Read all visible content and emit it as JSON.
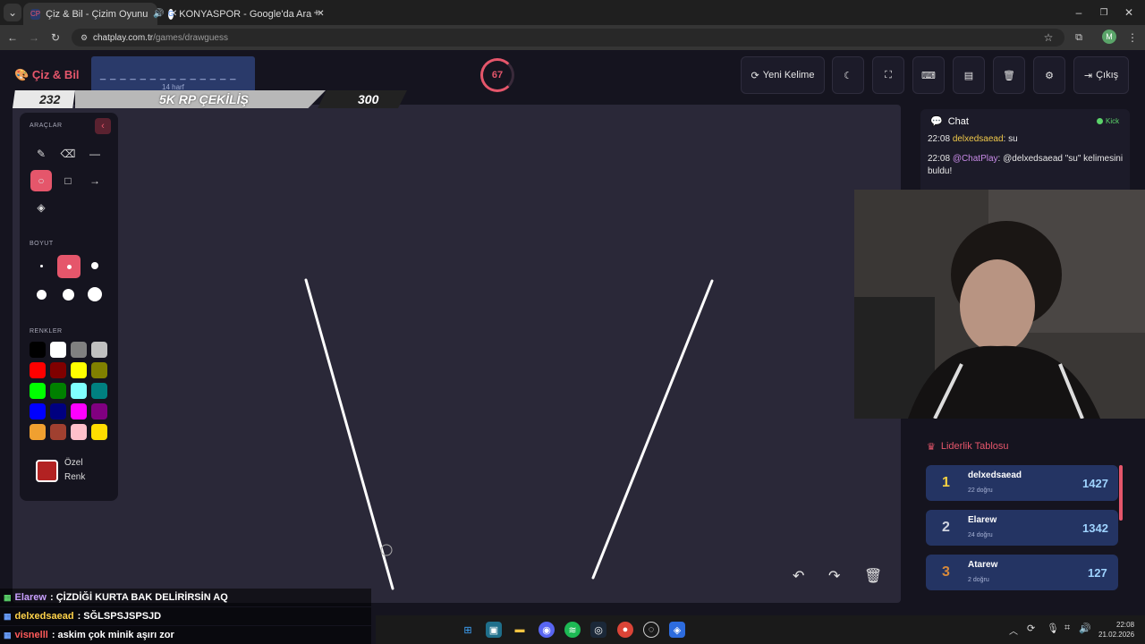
{
  "browser": {
    "tabs": [
      {
        "label": "Çiz & Bil - Çizim Oyunu",
        "favicon": "CP",
        "active": true
      },
      {
        "label": "KONYASPOR - Google'da Ara",
        "favicon": "G",
        "active": false
      }
    ],
    "url_host": "chatplay.com.tr",
    "url_path": "/games/drawguess",
    "profile_initial": "M"
  },
  "app": {
    "logo": "Çiz & Bil",
    "word_mask": "_ _ _ _ _ _ _ _ _ _ _ _ _ _",
    "word_hint": "14 harf",
    "timer": "67",
    "new_word_label": "Yeni Kelime",
    "exit_label": "Çıkış"
  },
  "banner": {
    "left": "232",
    "middle": "5K RP ÇEKİLİŞ",
    "right": "300"
  },
  "tools": {
    "section_tools": "ARAÇLAR",
    "section_size": "BOYUT",
    "section_colors": "RENKLER",
    "custom_color_label_1": "Özel",
    "custom_color_label_2": "Renk",
    "colors": [
      "#000000",
      "#ffffff",
      "#808080",
      "#c0c0c0",
      "#ff0000",
      "#800000",
      "#ffff00",
      "#808000",
      "#00ff00",
      "#008000",
      "#80ffff",
      "#008080",
      "#0000ff",
      "#000080",
      "#ff00ff",
      "#800080",
      "#f0a030",
      "#a04030",
      "#ffc0cb",
      "#ffdd00"
    ],
    "custom_color": "#b22222"
  },
  "chat": {
    "title": "Chat",
    "source": "Kick",
    "messages": [
      {
        "time": "22:08",
        "user": "delxedsaead",
        "text": ": su"
      },
      {
        "time": "22:08",
        "user": "@ChatPlay",
        "text": ": @delxedsaead \"su\" kelimesini buldu!"
      }
    ]
  },
  "leaderboard": {
    "title": "Liderlik Tablosu",
    "rows": [
      {
        "rank": "1",
        "name": "delxedsaead",
        "sub": "22 doğru",
        "score": "1427"
      },
      {
        "rank": "2",
        "name": "Elarew",
        "sub": "24 doğru",
        "score": "1342"
      },
      {
        "rank": "3",
        "name": "Atarew",
        "sub": "2 doğru",
        "score": "127"
      }
    ]
  },
  "stream_chat": [
    {
      "user": "Elarew",
      "text": ": ÇİZDİĞİ KURTA BAK DELİRİRSİN AQ",
      "color": "#c9a0ff"
    },
    {
      "user": "delxedsaead",
      "text": ": SĞLSPSJSPSJD",
      "color": "#ffd34a"
    },
    {
      "user": "visnelll",
      "text": ": askim çok minik aşırı zor",
      "color": "#ff5a5a"
    }
  ],
  "clock": {
    "time": "22:08",
    "date": "21.02.2026"
  }
}
